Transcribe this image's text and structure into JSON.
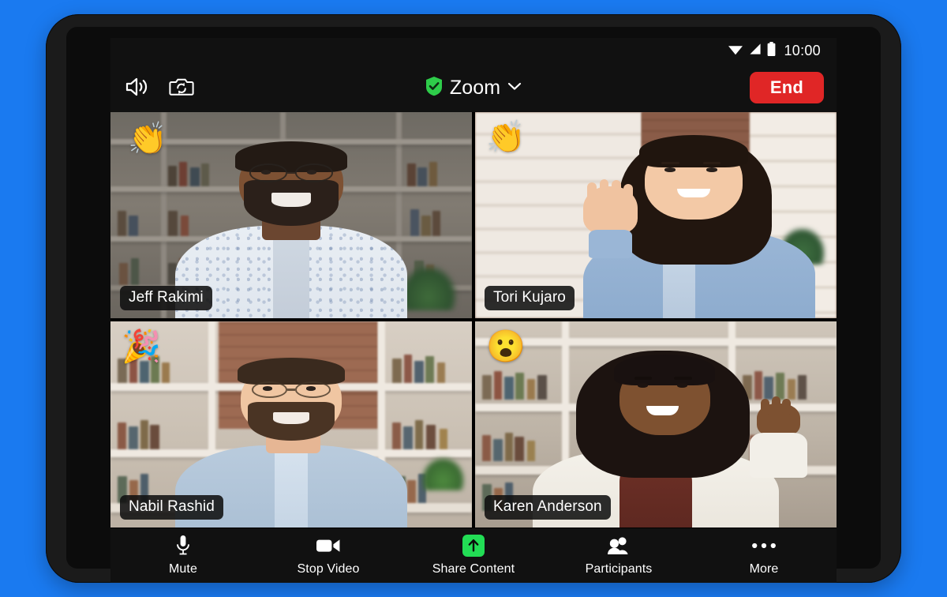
{
  "device": {
    "background_color": "#1a7af0",
    "frame_color": "#1b1b1b",
    "front_camera": "front-camera-dot"
  },
  "status_bar": {
    "time": "10:00",
    "icons": [
      "wifi-icon",
      "cellular-signal-icon",
      "battery-icon"
    ]
  },
  "header": {
    "speaker_icon": "speaker-icon",
    "flip_camera_icon": "flip-camera-icon",
    "shield_icon": "shield-check-icon",
    "title": "Zoom",
    "chevron_icon": "chevron-down-icon",
    "end_label": "End",
    "end_color": "#e02626"
  },
  "meeting": {
    "active_speaker_color": "#13c233",
    "participants": [
      {
        "name": "Jeff Rakimi",
        "reaction": "👏",
        "reaction_name": "clapping-hands-reaction",
        "active": false
      },
      {
        "name": "Tori Kujaro",
        "reaction": "👏",
        "reaction_name": "clapping-hands-reaction",
        "active": true
      },
      {
        "name": "Nabil Rashid",
        "reaction": "🎉",
        "reaction_name": "party-popper-reaction",
        "active": false
      },
      {
        "name": "Karen Anderson",
        "reaction": "😮",
        "reaction_name": "surprised-face-reaction",
        "active": false
      }
    ]
  },
  "toolbar": {
    "items": [
      {
        "label": "Mute",
        "icon": "microphone-icon"
      },
      {
        "label": "Stop Video",
        "icon": "video-camera-icon"
      },
      {
        "label": "Share Content",
        "icon": "share-up-arrow-icon",
        "accent": "#22dd55"
      },
      {
        "label": "Participants",
        "icon": "participants-people-icon"
      },
      {
        "label": "More",
        "icon": "more-ellipsis-icon"
      }
    ]
  }
}
